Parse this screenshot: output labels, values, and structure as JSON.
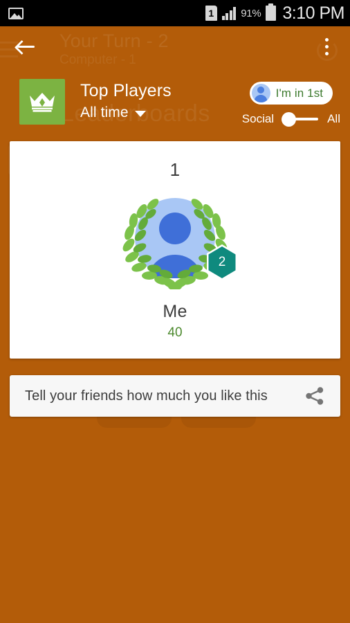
{
  "statusbar": {
    "photo_icon": "photo-icon",
    "sim_label": "1",
    "signal_icon": "signal-icon",
    "battery_percent": "91%",
    "battery_icon": "battery-icon",
    "clock": "3:10 PM"
  },
  "background": {
    "title": "Your Turn - 2",
    "subtitle": "Computer - 1",
    "watermark": "Leaderboards"
  },
  "appbar": {
    "back_label": "back-arrow-icon",
    "overflow_label": "overflow-menu-icon"
  },
  "leaderboard": {
    "icon": "crown-icon",
    "title": "Top Players",
    "period": "All time",
    "caret": "chevron-down-icon",
    "chip_text": "I'm in 1st",
    "toggle_left": "Social",
    "toggle_right": "All",
    "toggle_state": "Social"
  },
  "card": {
    "rank": "1",
    "name": "Me",
    "score": "40",
    "badge_level": "2",
    "avatar": "player-avatar",
    "wreath": "laurel-wreath-icon"
  },
  "share": {
    "text": "Tell your friends how much you like this",
    "icon": "share-icon"
  },
  "colors": {
    "background": "#b35c09",
    "accent_green": "#7cb342",
    "score_green": "#4d8a2f",
    "badge_teal": "#0f8a7e",
    "avatar_light": "#a9c7f5",
    "avatar_dark": "#3f6fd8"
  }
}
